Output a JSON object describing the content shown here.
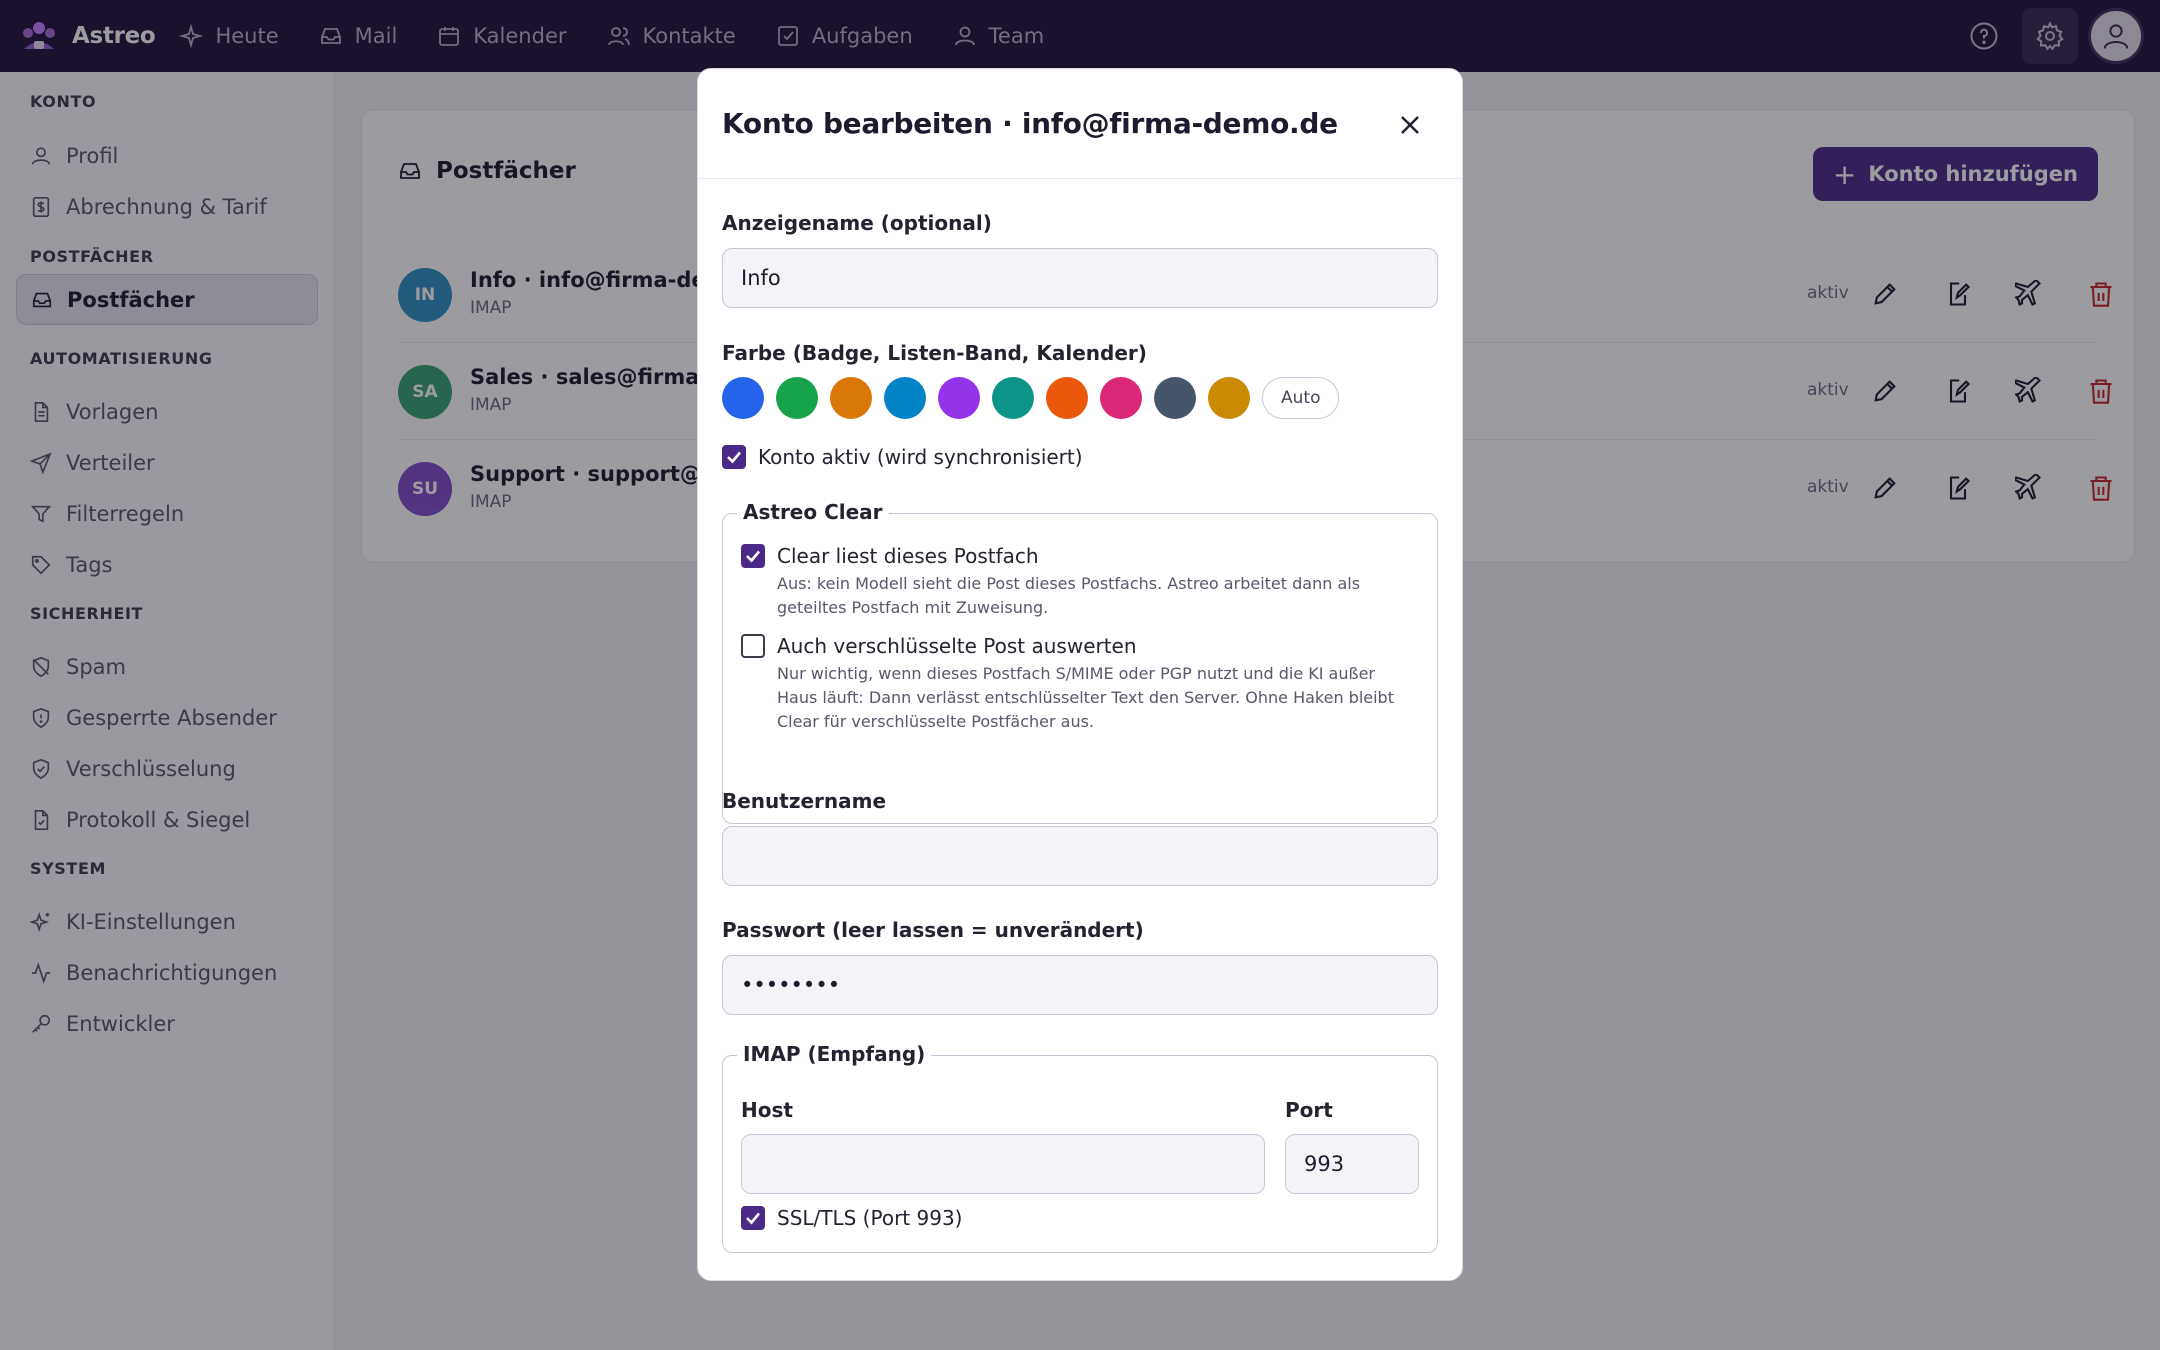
{
  "app": {
    "name": "Astreo",
    "nav": [
      "Heute",
      "Mail",
      "Kalender",
      "Kontakte",
      "Aufgaben",
      "Team"
    ]
  },
  "sidebar": {
    "sections": [
      {
        "title": "KONTO",
        "items": [
          "Profil",
          "Abrechnung & Tarif"
        ]
      },
      {
        "title": "POSTFÄCHER",
        "items": [
          "Postfächer"
        ]
      },
      {
        "title": "AUTOMATISIERUNG",
        "items": [
          "Vorlagen",
          "Verteiler",
          "Filterregeln",
          "Tags"
        ]
      },
      {
        "title": "SICHERHEIT",
        "items": [
          "Spam",
          "Gesperrte Absender",
          "Verschlüsselung",
          "Protokoll & Siegel"
        ]
      },
      {
        "title": "SYSTEM",
        "items": [
          "KI-Einstellungen",
          "Benachrichtigungen",
          "Entwickler"
        ]
      }
    ]
  },
  "main": {
    "title": "Postfächer",
    "add_label": "Konto hinzufügen",
    "accounts": [
      {
        "initials": "IN",
        "name": "Info · info@firma-demo",
        "protocol": "IMAP",
        "status": "aktiv",
        "color": "#0b7fb8"
      },
      {
        "initials": "SA",
        "name": "Sales · sales@firma-der",
        "protocol": "IMAP",
        "status": "aktiv",
        "color": "#13945a"
      },
      {
        "initials": "SU",
        "name": "Support · support@firm",
        "protocol": "IMAP",
        "status": "aktiv",
        "color": "#6a2fc0"
      }
    ]
  },
  "modal": {
    "title": "Konto bearbeiten · info@firma-demo.de",
    "display_name_label": "Anzeigename (optional)",
    "display_name_value": "Info",
    "color_label": "Farbe (Badge, Listen-Band, Kalender)",
    "colors": [
      "#2563eb",
      "#16a34a",
      "#d97706",
      "#0284c7",
      "#9333ea",
      "#0d9488",
      "#ea580c",
      "#db2777",
      "#475569",
      "#ca8a04"
    ],
    "auto_label": "Auto",
    "active_label": "Konto aktiv (wird synchronisiert)",
    "active_checked": true,
    "clear": {
      "legend": "Astreo Clear",
      "read_label": "Clear liest dieses Postfach",
      "read_checked": true,
      "read_help": "Aus: kein Modell sieht die Post dieses Postfachs. Astreo arbeitet dann als geteiltes Postfach mit Zuweisung.",
      "encrypted_label": "Auch verschlüsselte Post auswerten",
      "encrypted_checked": false,
      "encrypted_help": "Nur wichtig, wenn dieses Postfach S/MIME oder PGP nutzt und die KI außer Haus läuft: Dann verlässt entschlüsselter Text den Server. Ohne Haken bleibt Clear für verschlüsselte Postfächer aus."
    },
    "username_label": "Benutzername",
    "username_value": "",
    "password_label": "Passwort (leer lassen = unverändert)",
    "password_value": "••••••••",
    "imap": {
      "legend": "IMAP (Empfang)",
      "host_label": "Host",
      "host_value": "",
      "port_label": "Port",
      "port_value": "993",
      "ssl_label": "SSL/TLS (Port 993)",
      "ssl_checked": true
    }
  }
}
